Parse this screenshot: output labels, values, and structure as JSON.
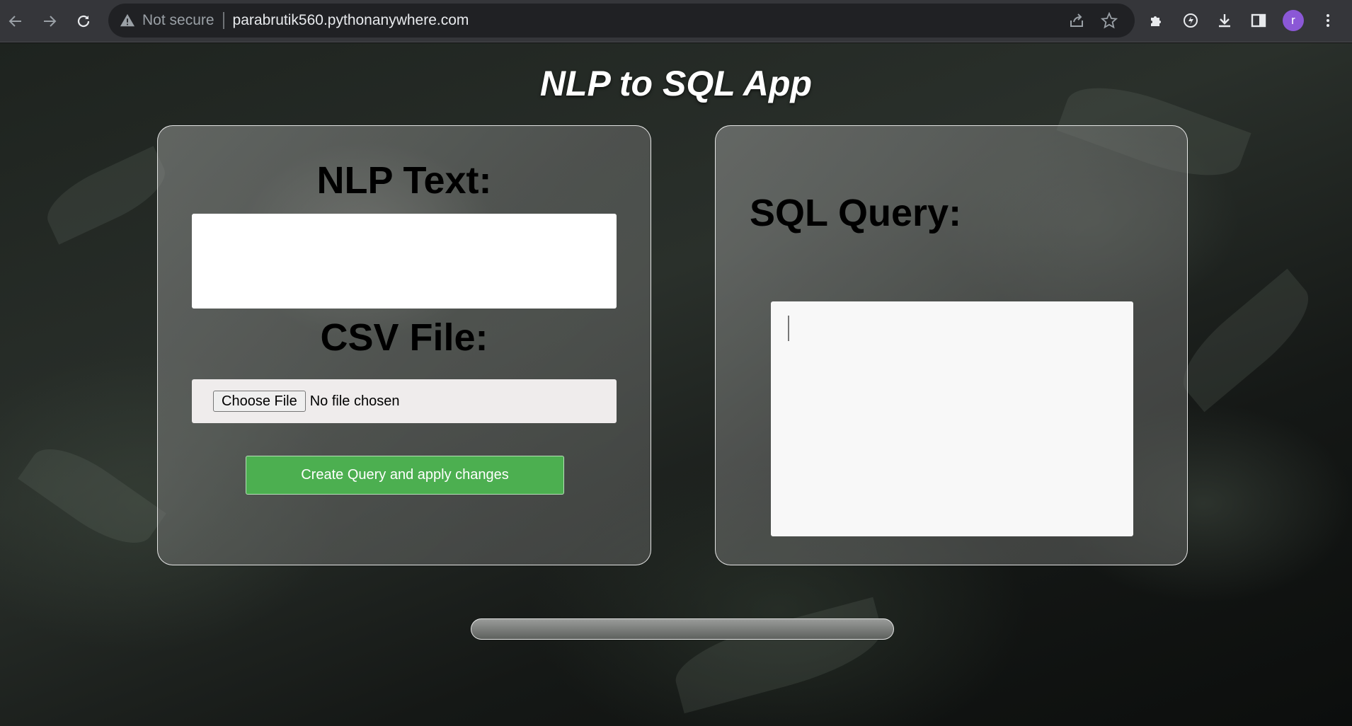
{
  "browser": {
    "security_label": "Not secure",
    "url": "parabrutik560.pythonanywhere.com",
    "avatar_letter": "r"
  },
  "app": {
    "title": "NLP to SQL App"
  },
  "left_panel": {
    "nlp_heading": "NLP Text:",
    "nlp_input_value": "",
    "csv_heading": "CSV File:",
    "choose_file_label": "Choose File",
    "file_status": "No file chosen",
    "create_button_label": "Create Query and apply changes"
  },
  "right_panel": {
    "sql_heading": "SQL Query:",
    "sql_output_value": ""
  },
  "colors": {
    "create_button": "#4caf50",
    "avatar": "#8b58d6"
  }
}
